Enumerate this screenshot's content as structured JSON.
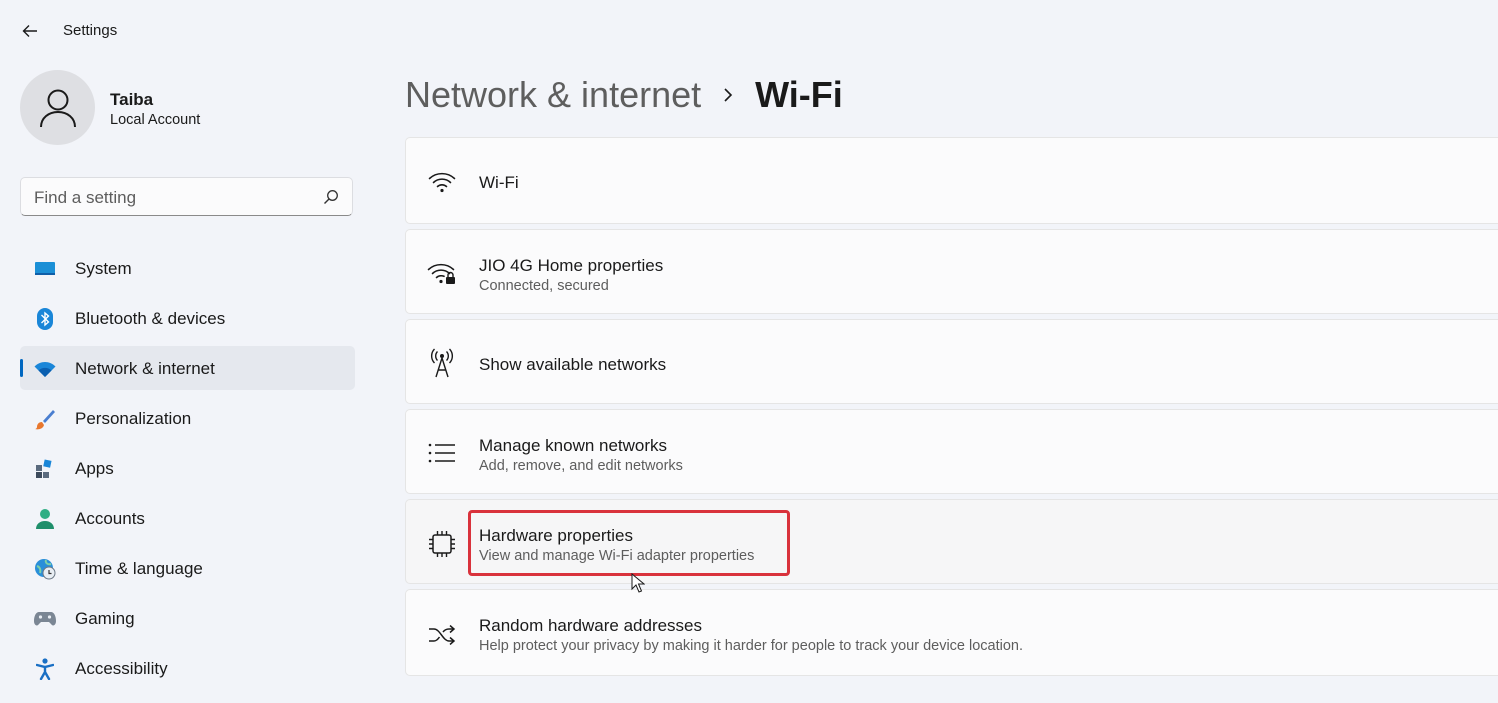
{
  "app": {
    "title": "Settings"
  },
  "profile": {
    "name": "Taiba",
    "account_type": "Local Account"
  },
  "search": {
    "placeholder": "Find a setting"
  },
  "sidebar": {
    "items": [
      {
        "label": "System",
        "icon": "system-icon",
        "active": false
      },
      {
        "label": "Bluetooth & devices",
        "icon": "bluetooth-icon",
        "active": false
      },
      {
        "label": "Network & internet",
        "icon": "wifi-icon",
        "active": true
      },
      {
        "label": "Personalization",
        "icon": "brush-icon",
        "active": false
      },
      {
        "label": "Apps",
        "icon": "apps-icon",
        "active": false
      },
      {
        "label": "Accounts",
        "icon": "accounts-icon",
        "active": false
      },
      {
        "label": "Time & language",
        "icon": "globe-clock-icon",
        "active": false
      },
      {
        "label": "Gaming",
        "icon": "gamepad-icon",
        "active": false
      },
      {
        "label": "Accessibility",
        "icon": "accessibility-icon",
        "active": false
      }
    ]
  },
  "breadcrumb": {
    "parent": "Network & internet",
    "current": "Wi-Fi"
  },
  "cards": [
    {
      "title": "Wi-Fi",
      "subtitle": "",
      "icon": "wifi-icon"
    },
    {
      "title": "JIO 4G Home properties",
      "subtitle": "Connected, secured",
      "icon": "wifi-lock-icon"
    },
    {
      "title": "Show available networks",
      "subtitle": "",
      "icon": "antenna-icon"
    },
    {
      "title": "Manage known networks",
      "subtitle": "Add, remove, and edit networks",
      "icon": "list-icon"
    },
    {
      "title": "Hardware properties",
      "subtitle": "View and manage Wi-Fi adapter properties",
      "icon": "chip-icon"
    },
    {
      "title": "Random hardware addresses",
      "subtitle": "Help protect your privacy by making it harder for people to track your device location.",
      "icon": "shuffle-icon"
    }
  ],
  "colors": {
    "accent": "#0067c0",
    "highlight": "#d9323c",
    "background": "#f2f4f9"
  }
}
